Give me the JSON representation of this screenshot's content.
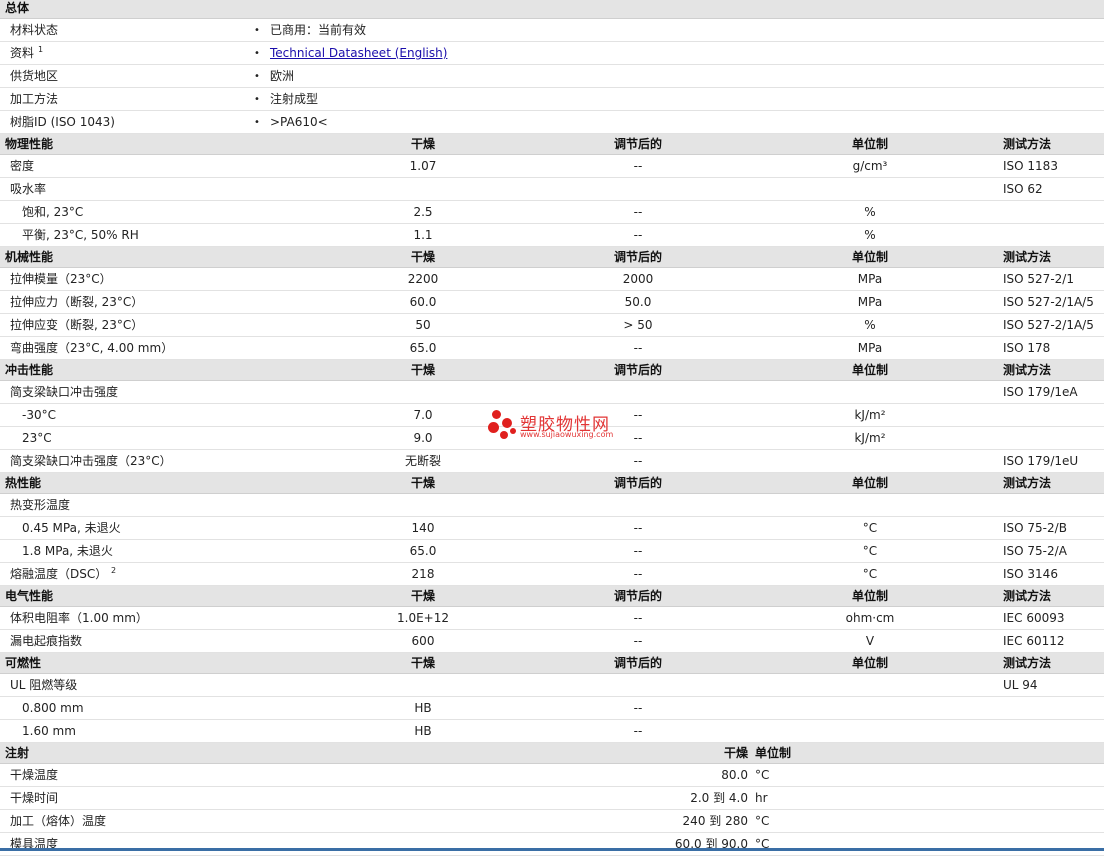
{
  "general": {
    "header": "总体",
    "rows": [
      {
        "label": "材料状态",
        "value": "已商用：当前有效"
      },
      {
        "label": "资料",
        "sup": "1",
        "value": "Technical Datasheet (English)"
      },
      {
        "label": "供货地区",
        "value": "欧洲"
      },
      {
        "label": "加工方法",
        "value": "注射成型"
      },
      {
        "label": "树脂ID (ISO 1043)",
        "value": ">PA610<"
      }
    ]
  },
  "columns": {
    "dry": "干燥",
    "conditioned": "调节后的",
    "unit": "单位制",
    "method": "测试方法"
  },
  "bullet": "•",
  "physical": {
    "header": "物理性能",
    "rows": [
      {
        "label": "密度",
        "dry": "1.07",
        "cond": "--",
        "unit": "g/cm³",
        "method": "ISO 1183"
      },
      {
        "label": "吸水率",
        "dry": "",
        "cond": "",
        "unit": "",
        "method": "ISO 62"
      },
      {
        "label": "饱和, 23°C",
        "dry": "2.5",
        "cond": "--",
        "unit": "%",
        "method": ""
      },
      {
        "label": "平衡, 23°C, 50% RH",
        "dry": "1.1",
        "cond": "--",
        "unit": "%",
        "method": ""
      }
    ]
  },
  "mechanical": {
    "header": "机械性能",
    "rows": [
      {
        "label": "拉伸模量（23°C）",
        "dry": "2200",
        "cond": "2000",
        "unit": "MPa",
        "method": "ISO 527-2/1"
      },
      {
        "label": "拉伸应力（断裂, 23°C）",
        "dry": "60.0",
        "cond": "50.0",
        "unit": "MPa",
        "method": "ISO 527-2/1A/5"
      },
      {
        "label": "拉伸应变（断裂, 23°C）",
        "dry": "50",
        "cond": "> 50",
        "unit": "%",
        "method": "ISO 527-2/1A/5"
      },
      {
        "label": "弯曲强度（23°C, 4.00 mm）",
        "dry": "65.0",
        "cond": "--",
        "unit": "MPa",
        "method": "ISO 178"
      }
    ]
  },
  "impact": {
    "header": "冲击性能",
    "rows": [
      {
        "label": "简支梁缺口冲击强度",
        "dry": "",
        "cond": "",
        "unit": "",
        "method": "ISO 179/1eA"
      },
      {
        "label": "-30°C",
        "dry": "7.0",
        "cond": "--",
        "unit": "kJ/m²",
        "method": ""
      },
      {
        "label": "23°C",
        "dry": "9.0",
        "cond": "--",
        "unit": "kJ/m²",
        "method": ""
      },
      {
        "label": "简支梁缺口冲击强度（23°C）",
        "dry": "无断裂",
        "cond": "--",
        "unit": "",
        "method": "ISO 179/1eU"
      }
    ]
  },
  "thermal": {
    "header": "热性能",
    "rows": [
      {
        "label": "热变形温度",
        "dry": "",
        "cond": "",
        "unit": "",
        "method": ""
      },
      {
        "label": "0.45 MPa, 未退火",
        "dry": "140",
        "cond": "--",
        "unit": "°C",
        "method": "ISO 75-2/B"
      },
      {
        "label": "1.8 MPa, 未退火",
        "dry": "65.0",
        "cond": "--",
        "unit": "°C",
        "method": "ISO 75-2/A"
      },
      {
        "label": "熔融温度（DSC）",
        "sup": "2",
        "dry": "218",
        "cond": "--",
        "unit": "°C",
        "method": "ISO 3146"
      }
    ]
  },
  "electrical": {
    "header": "电气性能",
    "rows": [
      {
        "label": "体积电阻率（1.00 mm）",
        "dry": "1.0E+12",
        "cond": "--",
        "unit": "ohm·cm",
        "method": "IEC 60093"
      },
      {
        "label": "漏电起痕指数",
        "dry": "600",
        "cond": "--",
        "unit": "V",
        "method": "IEC 60112"
      }
    ]
  },
  "flammability": {
    "header": "可燃性",
    "rows": [
      {
        "label": "UL 阻燃等级",
        "dry": "",
        "cond": "",
        "unit": "",
        "method": "UL 94"
      },
      {
        "label": "0.800 mm",
        "dry": "HB",
        "cond": "--",
        "unit": "",
        "method": ""
      },
      {
        "label": "1.60 mm",
        "dry": "HB",
        "cond": "--",
        "unit": "",
        "method": ""
      }
    ]
  },
  "injection": {
    "header": "注射",
    "col_dry": "干燥",
    "col_unit": "单位制",
    "rows": [
      {
        "label": "干燥温度",
        "value": "80.0",
        "unit": "°C"
      },
      {
        "label": "干燥时间",
        "value": "2.0 到 4.0",
        "unit": "hr"
      },
      {
        "label": "加工（熔体）温度",
        "value": "240 到 280",
        "unit": "°C"
      },
      {
        "label": "模具温度",
        "value": "60.0 到 90.0",
        "unit": "°C"
      }
    ]
  },
  "watermark": {
    "title": "塑胶物性网",
    "url": "www.sujiaowuxing.com"
  },
  "colors": {
    "header_bg": "#e4e4e4",
    "link": "#1a0dab",
    "watermark": "#e23535",
    "bottom_bar": "#3a6ea5"
  }
}
